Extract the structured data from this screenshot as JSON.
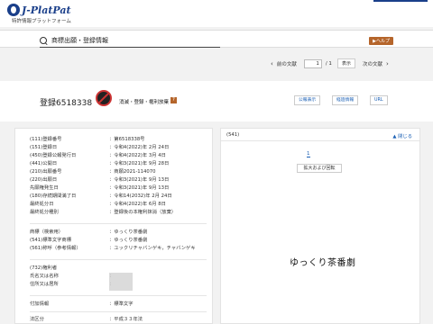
{
  "header": {
    "logo_text": "J-PlatPat",
    "logo_subtitle": "特許情報プラットフォーム"
  },
  "title_bar": {
    "title": "商標出願・登録情報",
    "help_label": "▶ヘルプ"
  },
  "pager": {
    "prev": "前の文献",
    "current_page": "1",
    "total": "/ 1",
    "show_button": "表示",
    "next": "次の文献"
  },
  "record": {
    "number": "登録6518338",
    "status": "消滅・登録・権利放棄",
    "question": "?",
    "buttons": [
      "公報表示",
      "経過情報",
      "URL"
    ]
  },
  "details": {
    "group1": [
      {
        "label": "(111)登録番号",
        "value": "：第6518338号"
      },
      {
        "label": "(151)登録日",
        "value": "：令和4(2022)年 2月 24日"
      },
      {
        "label": "(450)登録公報発行日",
        "value": "：令和4(2022)年 3月 4日"
      },
      {
        "label": "(441)公開日",
        "value": "：令和3(2021)年 9月 28日"
      },
      {
        "label": "(210)出願番号",
        "value": "：商願2021-114070"
      },
      {
        "label": "(220)出願日",
        "value": "：令和3(2021)年 9月 13日"
      },
      {
        "label": "先願権発生日",
        "value": "：令和3(2021)年 9月 13日"
      },
      {
        "label": "(180)存続期間満了日",
        "value": "：令和14(2032)年 2月 24日"
      },
      {
        "label": "最終処分日",
        "value": "：令和4(2022)年 6月 8日"
      },
      {
        "label": "最終処分種別",
        "value": "：登録後の本権利抹消（放棄）"
      }
    ],
    "group2": [
      {
        "label": "商標（検索用）",
        "value": "：ゆっくり茶番劇"
      },
      {
        "label": "(541)標準文字商標",
        "value": "：ゆっくり茶番劇"
      },
      {
        "label": "(561)称呼（参考情報）",
        "value": "：ユックリチャバンゲキ，チャバンゲキ"
      }
    ],
    "group3": [
      {
        "label": "(732)権利者",
        "value": ""
      },
      {
        "label": "氏名又は名称",
        "value": "："
      },
      {
        "label": "住所又は居所",
        "value": "："
      }
    ],
    "group4": [
      {
        "label": "付加情報",
        "value": "：標準文字"
      }
    ],
    "group5": [
      {
        "label": "法区分",
        "value": "：平成３３年法"
      }
    ]
  },
  "right_panel": {
    "code": "(541)",
    "close_label": "▲ 閉じる",
    "page_num": "1",
    "zoom_button": "拡大および回転",
    "mark_text": "ゆっくり茶番劇"
  }
}
